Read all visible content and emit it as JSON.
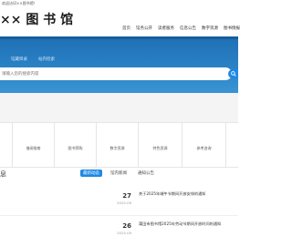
{
  "header": {
    "welcome": "欢迎访问××图书馆！",
    "logo": "×× 图 书 馆"
  },
  "nav": {
    "items": [
      "首页",
      "馆务公开",
      "读者服务",
      "信息公告",
      "数字资源",
      "图书情报"
    ]
  },
  "banner": {
    "tab1": "馆藏目录",
    "tab2": "站内检索"
  },
  "search": {
    "placeholder": "请输入您的搜索内容",
    "button_icon": "search-icon"
  },
  "services": [
    {
      "label": "",
      "icon": "blank-icon"
    },
    {
      "label": "借阅指南",
      "icon": "book-icon"
    },
    {
      "label": "图书荐购",
      "icon": "cart-icon"
    },
    {
      "label": "数字资源",
      "icon": "database-icon"
    },
    {
      "label": "特色资源",
      "icon": "star-icon"
    },
    {
      "label": "参考咨询",
      "icon": "question-icon"
    }
  ],
  "news": {
    "section_mark": "息",
    "tabs": [
      "最新动态",
      "馆内新闻",
      "通知公告"
    ],
    "active_tab": 0,
    "items": [
      {
        "day": "27",
        "ym": "2025-09",
        "title": "关于2025年端午节期间开放安排的通知"
      },
      {
        "day": "26",
        "ym": "2025-09",
        "title": "莆田市图书馆2025年劳动节期间开放时间的通知"
      }
    ]
  },
  "colors": {
    "accent": "#1e88e5",
    "banner": "#2a82c6"
  }
}
